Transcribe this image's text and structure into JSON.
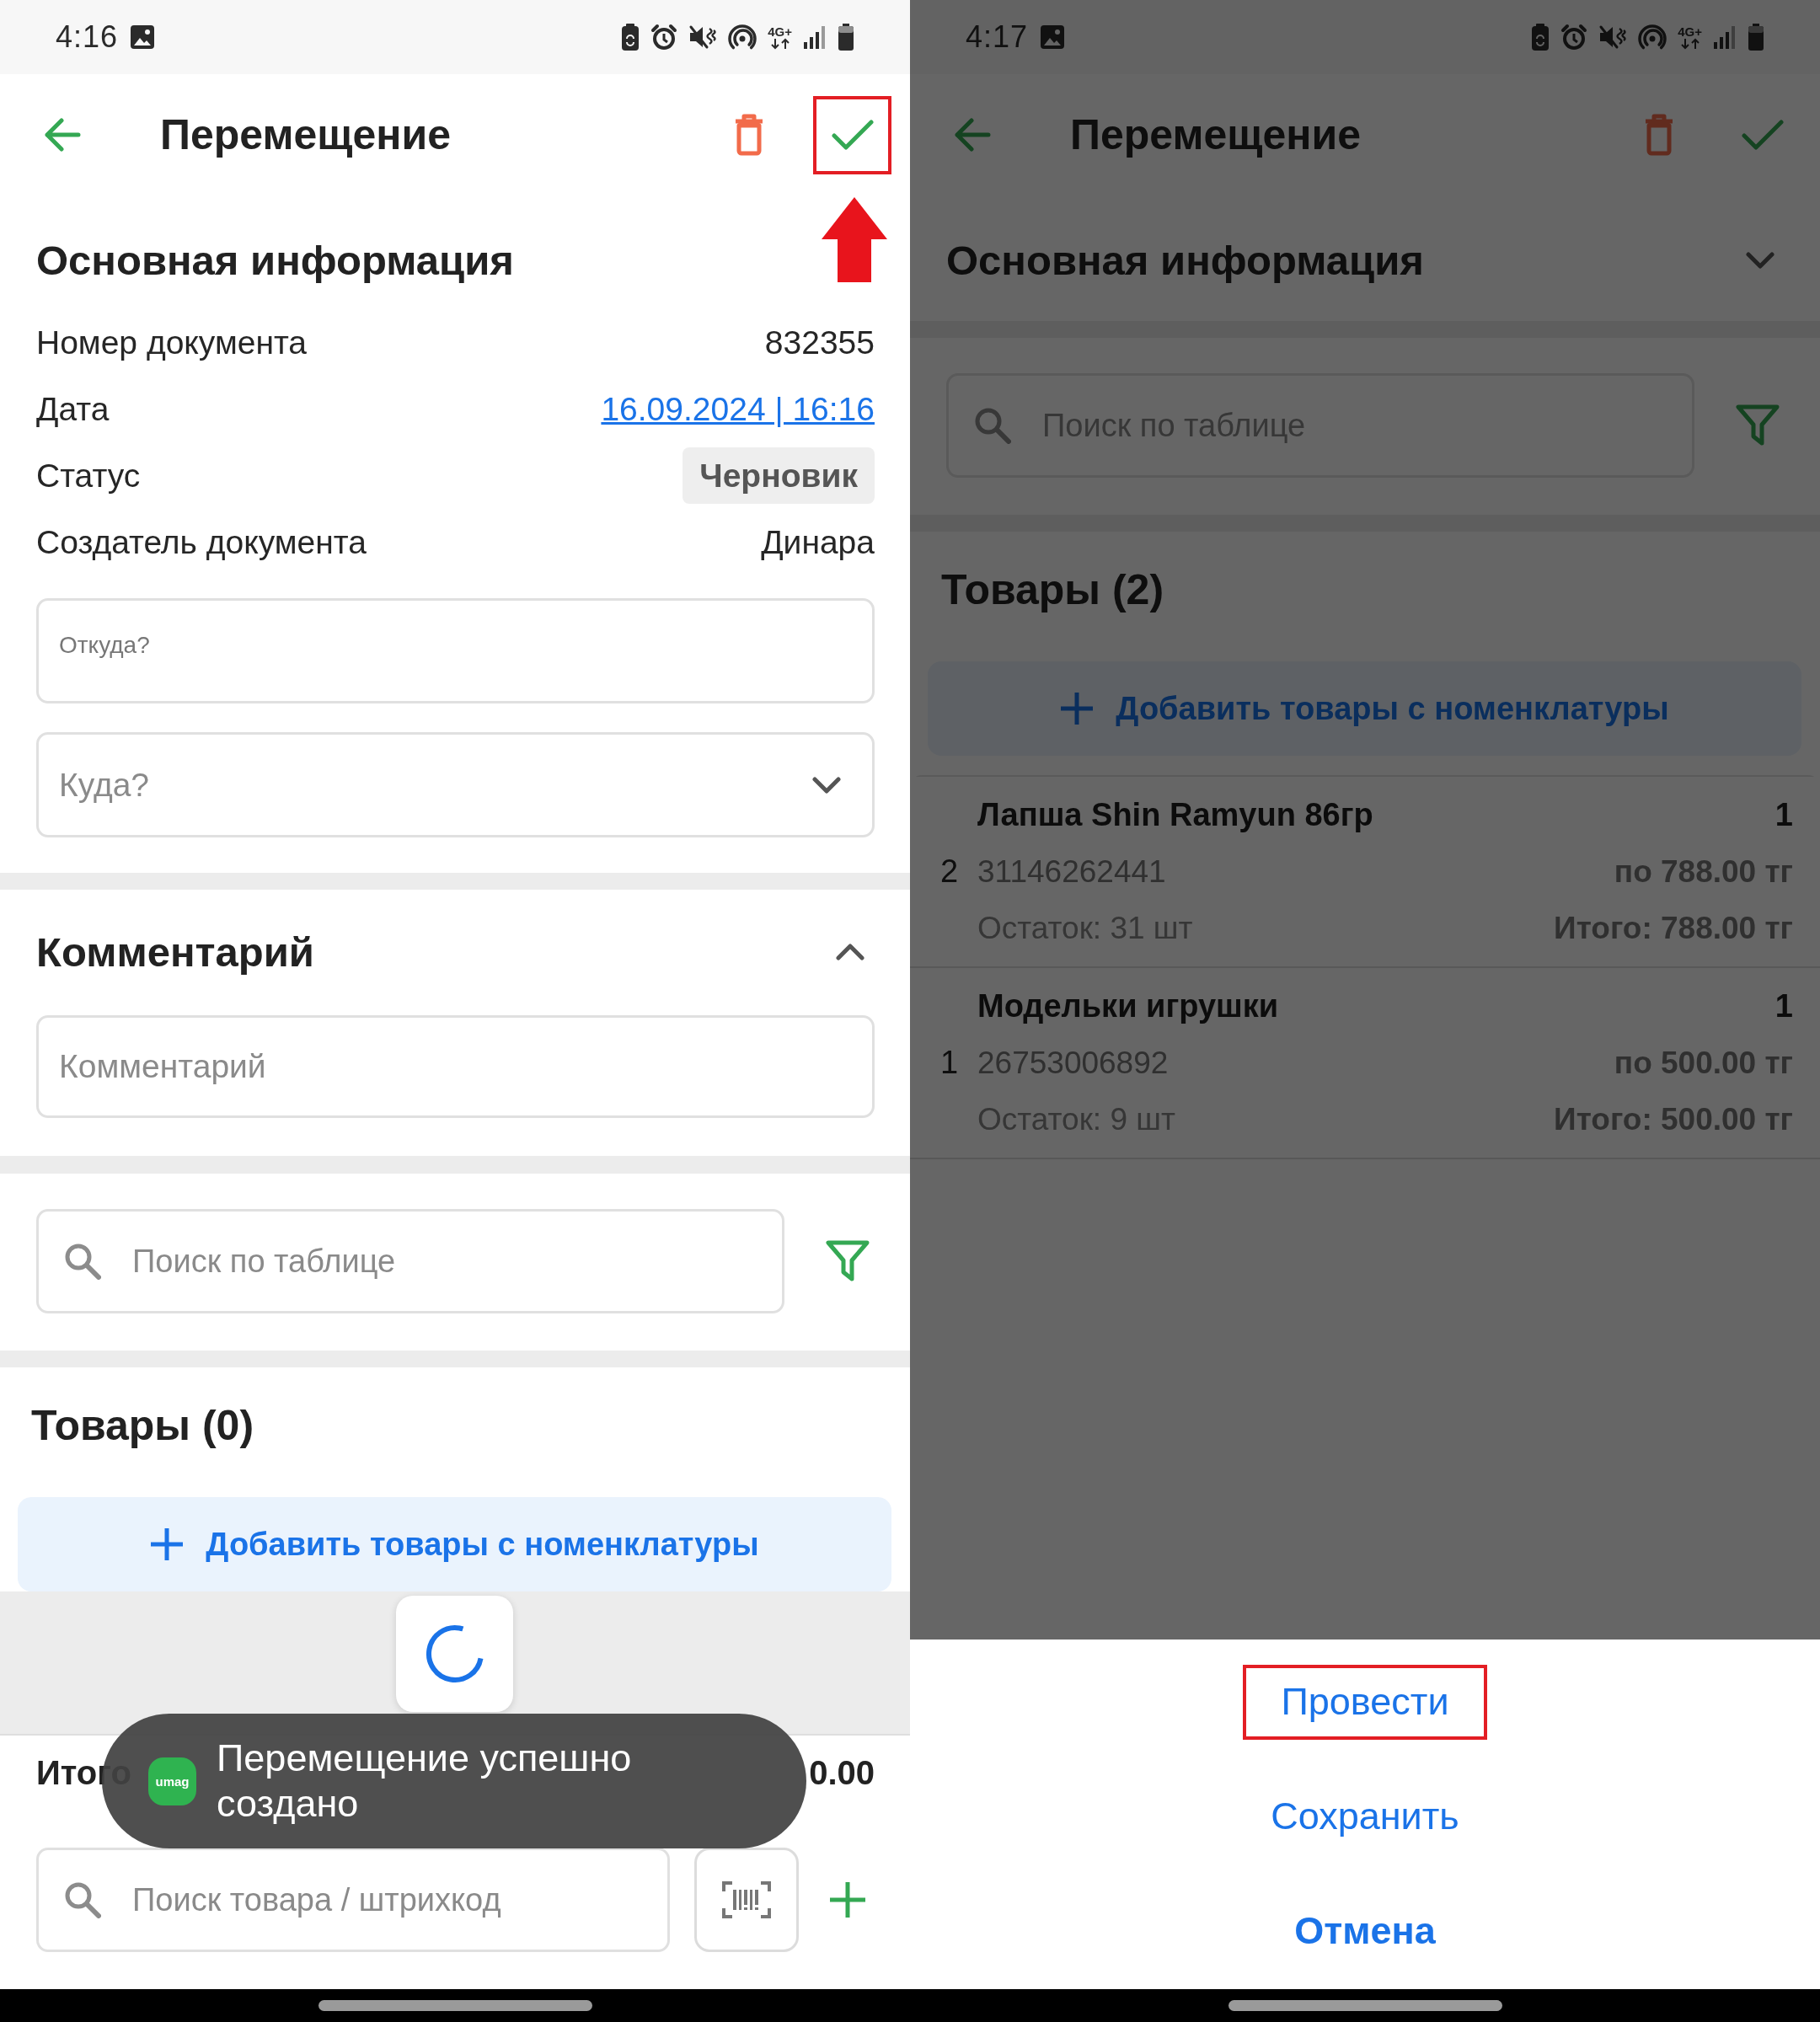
{
  "screens": [
    {
      "dimmed": false,
      "status_bar": {
        "time": "4:16",
        "network": "4G+"
      },
      "app_bar": {
        "title": "Перемещение",
        "confirm_highlighted": true,
        "pointer_arrow": true
      },
      "main_info": {
        "title": "Основная информация",
        "expanded": true,
        "rows": [
          {
            "kind": "text",
            "label": "Номер документа",
            "value": "832355"
          },
          {
            "kind": "link",
            "label": "Дата",
            "value": "16.09.2024 | 16:16"
          },
          {
            "kind": "tag",
            "label": "Статус",
            "value": "Черновик"
          },
          {
            "kind": "text",
            "label": "Создатель документа",
            "value": "Динара"
          }
        ],
        "fields": [
          {
            "kind": "floating",
            "label": "Откуда?"
          },
          {
            "kind": "dropdown",
            "placeholder": "Куда?"
          }
        ]
      },
      "comment": {
        "title": "Комментарий",
        "expanded": true,
        "placeholder": "Комментарий"
      },
      "table_search": {
        "placeholder": "Поиск по таблице"
      },
      "goods": {
        "title": "Товары (0)",
        "add_button": "Добавить товары с номенклатуры",
        "loading": true
      },
      "footer": {
        "total_label": "Итого",
        "total_value": "0.00",
        "search_placeholder": "Поиск товара / штрихкод"
      },
      "toast": {
        "app_logo": "umag",
        "message": "Перемещение успешно создано"
      }
    },
    {
      "dimmed": true,
      "status_bar": {
        "time": "4:17",
        "network": "4G+"
      },
      "app_bar": {
        "title": "Перемещение",
        "confirm_highlighted": false,
        "pointer_arrow": false
      },
      "main_info": {
        "title": "Основная информация",
        "expanded": false
      },
      "table_search": {
        "placeholder": "Поиск по таблице"
      },
      "goods": {
        "title": "Товары (2)",
        "add_button": "Добавить товары с номенклатуры",
        "loading": false,
        "items": [
          {
            "index": "2",
            "name": "Лапша Shin Ramyun 86гр",
            "quantity": "1",
            "barcode": "31146262441",
            "price": "по 788.00 тг",
            "stock": "Остаток: 31 шт",
            "total": "Итого: 788.00 тг"
          },
          {
            "index": "1",
            "name": "Модельки игрушки",
            "quantity": "1",
            "barcode": "26753006892",
            "price": "по 500.00 тг",
            "stock": "Остаток: 9 шт",
            "total": "Итого: 500.00 тг"
          }
        ]
      },
      "action_sheet": {
        "options": [
          {
            "kind": "action",
            "label": "Провести",
            "highlighted": true
          },
          {
            "kind": "action",
            "label": "Сохранить",
            "highlighted": false
          },
          {
            "kind": "cancel",
            "label": "Отмена",
            "highlighted": false
          }
        ]
      }
    }
  ]
}
